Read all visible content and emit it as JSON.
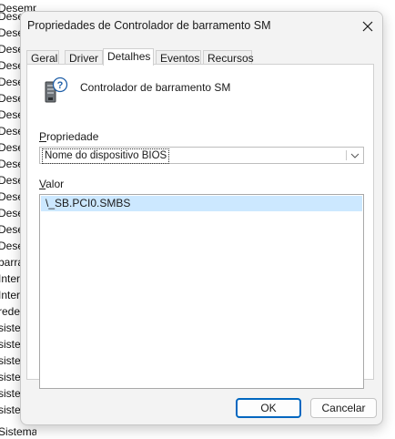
{
  "background_list": [
    "Desempenho",
    "Desempenho",
    "Desempenho",
    "Desempenho",
    "Desempenho",
    "Desempenho",
    "Desempenho",
    "Desempenho",
    "Desempenho",
    "Desempenho",
    "Desempenho",
    "Desempenho",
    "Desempenho",
    "Desempenho",
    "Desempenho",
    "Desempenho",
    "barramento",
    "Interface",
    "Interface",
    "rede",
    "sistema",
    "sistema",
    "sistema",
    "sistema",
    "sistema",
    "sistema",
    "Sistema básico"
  ],
  "dialog": {
    "title": "Propriedades de Controlador de barramento SM",
    "tabs": [
      "Geral",
      "Driver",
      "Detalhes",
      "Eventos",
      "Recursos"
    ],
    "active_tab": "Detalhes",
    "device_icon": "device-question-icon",
    "device_name": "Controlador de barramento SM",
    "property_label_accel": "P",
    "property_label_rest": "ropriedade",
    "property_selected": "Nome do dispositivo BIOS",
    "value_label_accel": "V",
    "value_label_rest": "alor",
    "values": [
      "\\_SB.PCI0.SMBS"
    ],
    "ok_label": "OK",
    "cancel_label": "Cancelar"
  },
  "colors": {
    "selection": "#cce8ff",
    "accent": "#0067c0",
    "dialog_bg": "#f3f3f3"
  }
}
